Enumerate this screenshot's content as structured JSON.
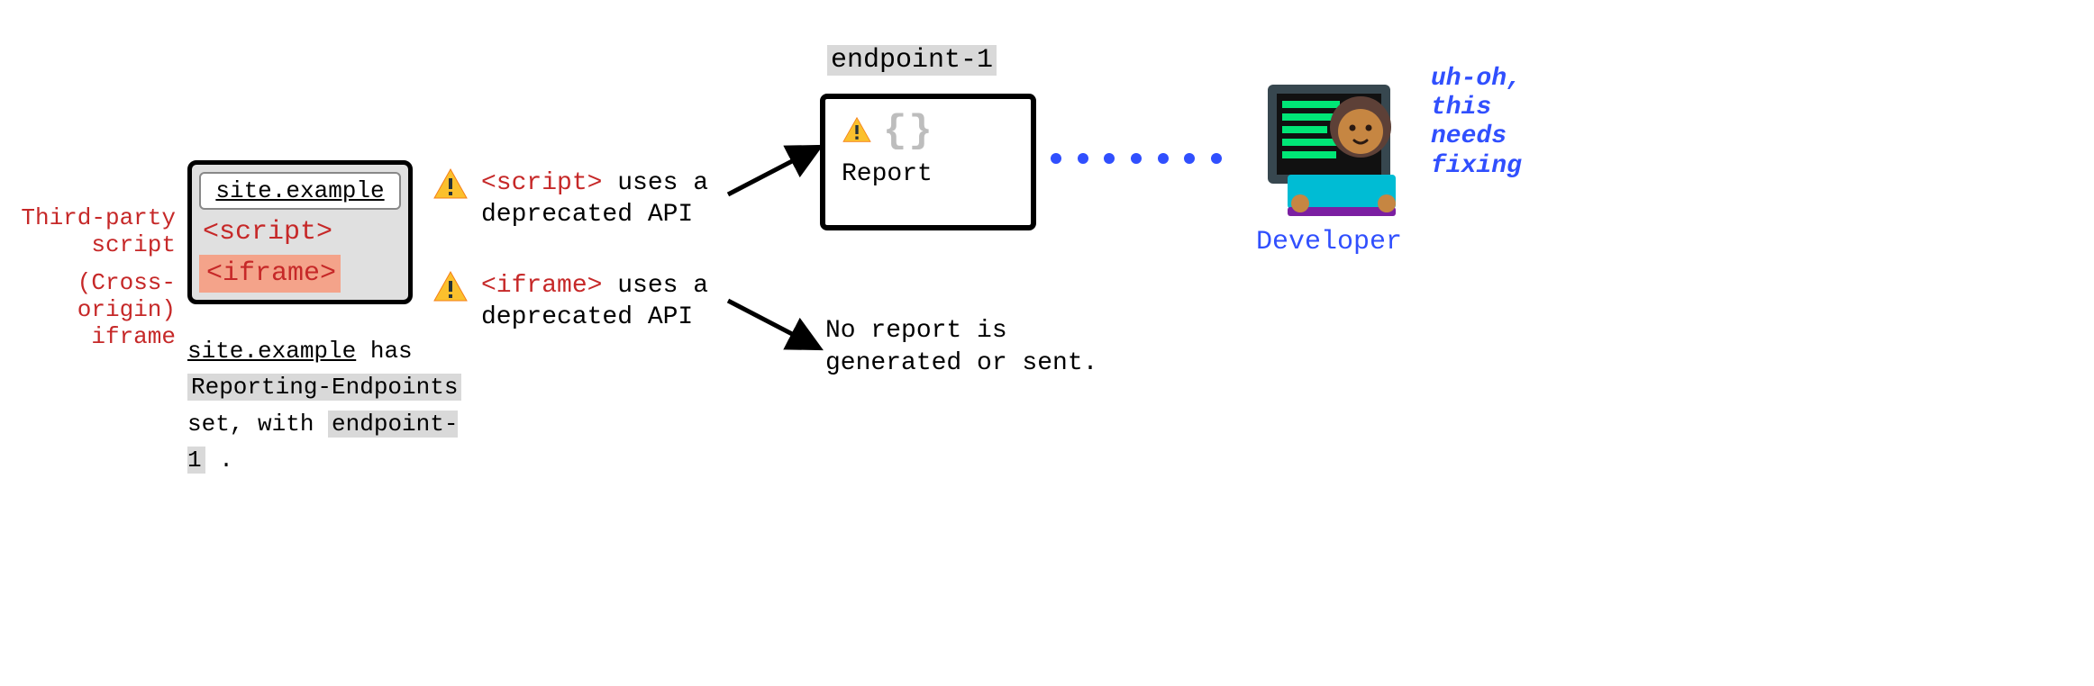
{
  "site": {
    "url": "site.example",
    "row_script": "<script>",
    "row_iframe": "<iframe>",
    "annot_script": "Third-party script",
    "annot_iframe": "(Cross-origin) iframe",
    "caption_url": "site.example",
    "caption_has": " has ",
    "caption_header": "Reporting-Endpoints",
    "caption_setwith": " set, with ",
    "caption_endpoint": "endpoint-1",
    "caption_period": " ."
  },
  "warnings": {
    "script_tag": "<script>",
    "script_rest": " uses a deprecated API",
    "iframe_tag": "<iframe>",
    "iframe_rest": " uses a deprecated API"
  },
  "endpoint": {
    "name": "endpoint-1",
    "curly": "{}",
    "report": "Report"
  },
  "no_report": "No report is generated or sent.",
  "developer": {
    "label": "Developer",
    "exclaim": "uh-oh, this needs fixing"
  },
  "icons": {
    "warn": "warning-triangle"
  }
}
